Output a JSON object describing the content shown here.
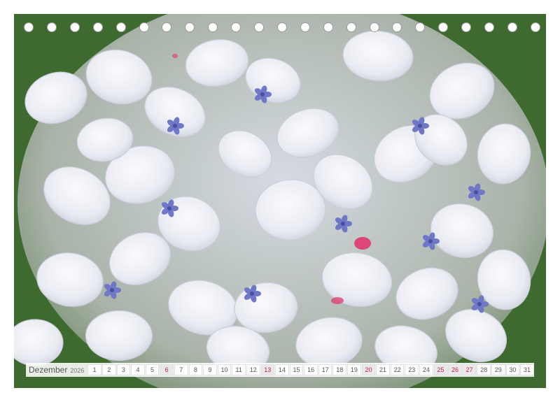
{
  "calendar": {
    "month": "Dezember",
    "year": "2026",
    "days": [
      {
        "n": "1",
        "type": "weekday"
      },
      {
        "n": "2",
        "type": "weekday"
      },
      {
        "n": "3",
        "type": "weekday"
      },
      {
        "n": "4",
        "type": "weekday"
      },
      {
        "n": "5",
        "type": "weekday"
      },
      {
        "n": "6",
        "type": "sunday"
      },
      {
        "n": "7",
        "type": "weekday"
      },
      {
        "n": "8",
        "type": "weekday"
      },
      {
        "n": "9",
        "type": "weekday"
      },
      {
        "n": "10",
        "type": "weekday"
      },
      {
        "n": "11",
        "type": "weekday"
      },
      {
        "n": "12",
        "type": "weekday"
      },
      {
        "n": "13",
        "type": "sunday"
      },
      {
        "n": "14",
        "type": "weekday"
      },
      {
        "n": "15",
        "type": "weekday"
      },
      {
        "n": "16",
        "type": "weekday"
      },
      {
        "n": "17",
        "type": "weekday"
      },
      {
        "n": "18",
        "type": "weekday"
      },
      {
        "n": "19",
        "type": "weekday"
      },
      {
        "n": "20",
        "type": "sunday"
      },
      {
        "n": "21",
        "type": "weekday"
      },
      {
        "n": "22",
        "type": "weekday"
      },
      {
        "n": "23",
        "type": "weekday"
      },
      {
        "n": "24",
        "type": "weekday"
      },
      {
        "n": "25",
        "type": "holiday"
      },
      {
        "n": "26",
        "type": "holiday"
      },
      {
        "n": "27",
        "type": "sunday"
      },
      {
        "n": "28",
        "type": "weekday"
      },
      {
        "n": "29",
        "type": "weekday"
      },
      {
        "n": "30",
        "type": "weekday"
      },
      {
        "n": "31",
        "type": "weekday"
      }
    ]
  },
  "colors": {
    "background_green": "#3f6a2f",
    "petal": "#eef0f6",
    "petal_shadow": "#c9cdd9",
    "stamen": "#6f78c8",
    "pink_spot": "#e0306a"
  }
}
